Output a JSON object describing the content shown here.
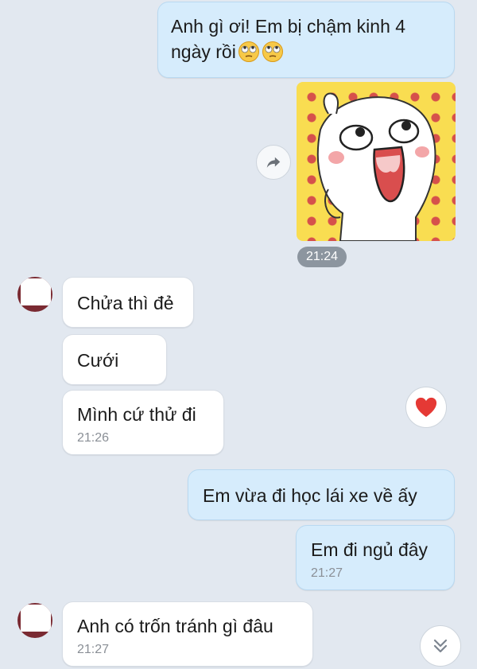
{
  "messages": {
    "m1": {
      "line1": "Anh gì ơi! Em bị chậm kinh 4",
      "line2": "ngày rồi"
    },
    "sticker_time": "21:24",
    "m2": {
      "text": "Chửa thì đẻ"
    },
    "m3": {
      "text": "Cưới"
    },
    "m4": {
      "text": "Mình cứ thử đi",
      "time": "21:26"
    },
    "m5": {
      "text": "Em vừa đi học lái xe về ấy"
    },
    "m6": {
      "text": "Em đi ngủ đây",
      "time": "21:27"
    },
    "m7": {
      "text": "Anh có trốn tránh gì đâu",
      "time": "21:27"
    }
  },
  "icons": {
    "forward": "share-arrow-icon",
    "reaction": "heart-icon",
    "scroll_down": "double-chevron-down-icon",
    "emoji": "eye-roll-emoji-icon"
  },
  "colors": {
    "background": "#e2e8f0",
    "outgoing_bubble": "#d6ecfc",
    "incoming_bubble": "#ffffff",
    "heart": "#e53935"
  }
}
